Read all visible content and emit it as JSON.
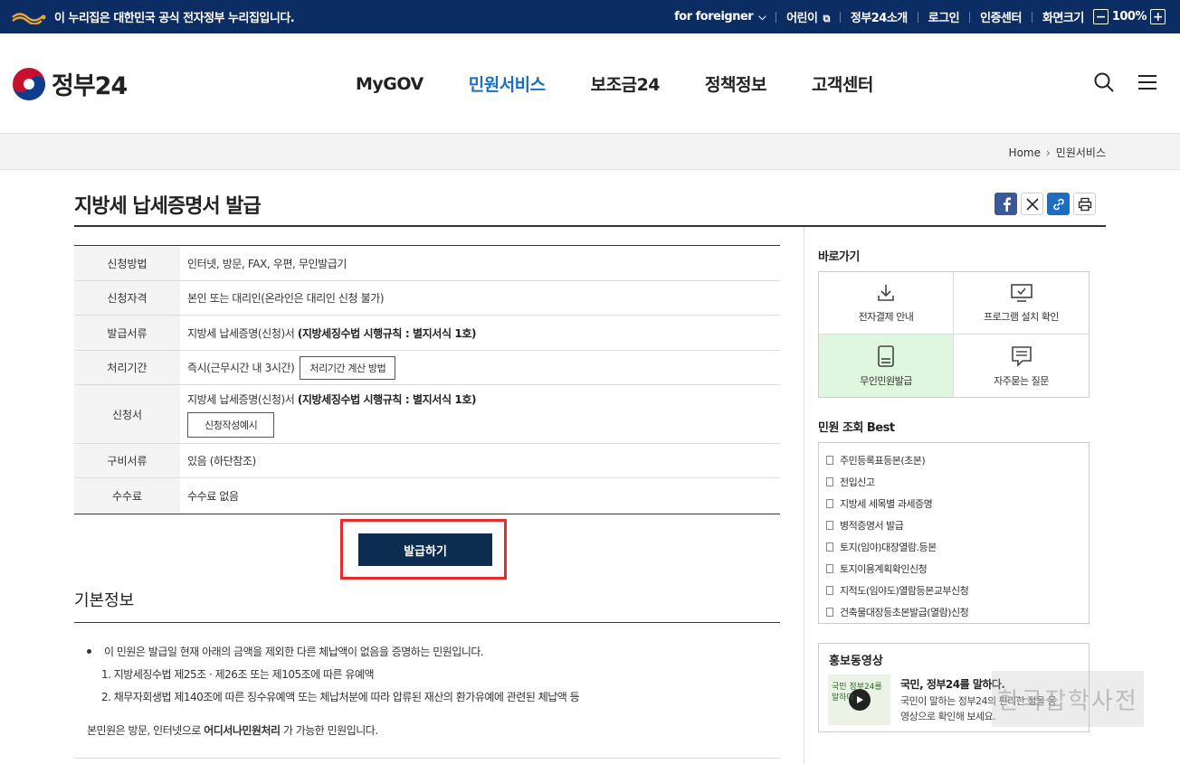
{
  "topbar": {
    "gov_notice": "이 누리집은 대한민국 공식 전자정부 누리집입니다.",
    "for_foreigner": "for foreigner",
    "kids": "어린이",
    "about": "정부24소개",
    "login": "로그인",
    "cert_center": "인증센터",
    "screen_size_label": "화면크기",
    "zoom_level": "100%",
    "zoom_minus": "−",
    "zoom_plus": "+"
  },
  "header": {
    "logo_text": "정부24",
    "nav": [
      "MyGOV",
      "민원서비스",
      "보조금24",
      "정책정보",
      "고객센터"
    ],
    "active_nav": "민원서비스"
  },
  "breadcrumb": {
    "home": "Home",
    "current": "민원서비스"
  },
  "page": {
    "title": "지방세 납세증명서 발급"
  },
  "info_table": {
    "method_label": "신청방법",
    "method_value": "인터넷, 방문, FAX, 우편, 무인발급기",
    "qual_label": "신청자격",
    "qual_value": "본인 또는 대리인(온라인은 대리인 신청 불가)",
    "doc_label": "발급서류",
    "doc_value": "지방세 납세증명(신청)서",
    "doc_value_bold": "(지방세징수법 시행규칙 : 별지서식 1호)",
    "period_label": "처리기간",
    "period_value": "즉시(근무시간 내 3시간)",
    "period_button": "처리기간 계산 방법",
    "form_label": "신청서",
    "form_value": "지방세 납세증명(신청)서",
    "form_value_bold": "(지방세징수법 시행규칙 : 별지서식 1호)",
    "form_button": "신청작성예시",
    "required_label": "구비서류",
    "required_value": "있음 (하단참조)",
    "fee_label": "수수료",
    "fee_value": "수수료 없음"
  },
  "issue_button": "발급하기",
  "basic": {
    "title": "기본정보",
    "item": "이 민원은 발급일 현재 아래의 금액을 제외한 다른 체납액이 없음을 증명하는 민원입니다.",
    "sub1": "1. 지방세징수법 제25조 · 제26조 또는 제105조에 따른 유예액",
    "sub2": "2. 채무자회생법 제140조에 따른 징수유예액 또는 체납처분에 따라 압류된 재산의 환가유예에 관련된 체납액 등",
    "note_prefix": "본민원은 방문, 인터넷으로 ",
    "note_bold": "어디서나민원처리",
    "note_suffix": " 가 가능한 민원입니다."
  },
  "sidebar": {
    "quick_title": "바로가기",
    "quick": [
      {
        "label": "전자결제 안내",
        "icon": "download-icon"
      },
      {
        "label": "프로그램 설치 확인",
        "icon": "monitor-check-icon"
      },
      {
        "label": "무인민원발급",
        "icon": "kiosk-icon"
      },
      {
        "label": "자주묻는 질문",
        "icon": "chat-icon"
      }
    ],
    "best_title": "민원 조회 Best",
    "best": [
      "주민등록표등본(초본)",
      "전입신고",
      "지방세 세목별 과세증명",
      "병적증명서 발급",
      "토지(임야)대장열람.등본",
      "토지이용계획확인신청",
      "지적도(임야도)열람등본교부신청",
      "건축물대장등초본발급(열람)신청"
    ],
    "promo_title": "홍보동영상",
    "promo_video_title": "국민, 정부24를 말하다.",
    "promo_video_desc": "국민이 말하는 정부24의 편리한 점을 동영상으로 확인해 보세요.",
    "thumb_text": "국민 정부24를 말하다"
  },
  "watermark": "한국잡학사전",
  "colors": {
    "topbar": "#0c2d63",
    "active_nav": "#1a6ec3",
    "issue_button": "#0c2d4f",
    "highlight_border": "#e52b2b",
    "green_cell": "#dff6df"
  }
}
